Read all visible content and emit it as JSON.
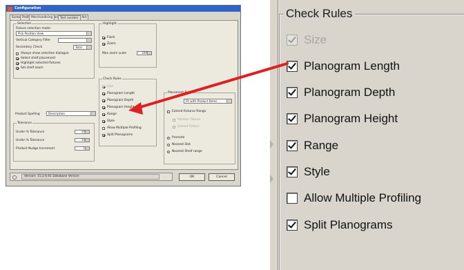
{
  "window": {
    "title": "Configuration",
    "tabs": [
      "Screen",
      "Profiling",
      "Configuration Profile",
      "Visual Aid",
      "Merchandising",
      "Test number"
    ],
    "selection": {
      "label": "Selection",
      "fixture_mode_label": "Fixture selection mode",
      "fixture_mode_value": "Pick Position View",
      "vertical_label": "Vertical Category Filter",
      "vertical_value": "",
      "secondary_label": "Secondary Check",
      "secondary_value": "Total"
    },
    "options": [
      {
        "label": "Always show selection dialogue",
        "checked": false
      },
      {
        "label": "Select shelf placement",
        "checked": true
      },
      {
        "label": "Highlight selected fixtures",
        "checked": true
      },
      {
        "label": "Set shelf zoom",
        "checked": true
      }
    ],
    "product_spelling": {
      "label": "Product Spelling",
      "value": "Description"
    },
    "tolerances": {
      "label": "Tolerance",
      "rows": [
        {
          "label": "Under % Tolerance",
          "value": "10"
        },
        {
          "label": "Under % Tolerance",
          "value": "10"
        },
        {
          "label": "Product Nudge Increment",
          "value": "1"
        }
      ]
    },
    "highlight": {
      "label": "Highlight",
      "items": [
        {
          "label": "Flash",
          "checked": true
        },
        {
          "label": "Zoom",
          "checked": true
        }
      ],
      "max_zoom_label": "Max zoom scale",
      "max_zoom_value": "100"
    },
    "check_rules_small": {
      "label": "Check Rules",
      "items": [
        {
          "label": "Size",
          "checked": true,
          "disabled": true
        },
        {
          "label": "Planogram Length",
          "checked": true
        },
        {
          "label": "Planogram Depth",
          "checked": true
        },
        {
          "label": "Planogram Height",
          "checked": true
        },
        {
          "label": "Range",
          "checked": true
        },
        {
          "label": "Style",
          "checked": true
        },
        {
          "label": "Allow Multiple Profiling",
          "checked": false
        },
        {
          "label": "Split Planograms",
          "checked": true
        }
      ]
    },
    "placement": {
      "label": "Placement Rules",
      "combo_value": "Fit with Product Items",
      "extend_label": "Extend Fixtures Range",
      "sub_items": [
        "Position Fixture",
        "Extend Fixture"
      ],
      "radios": [
        {
          "label": "Promote",
          "selected": false
        },
        {
          "label": "Nearest Slot",
          "selected": false
        },
        {
          "label": "Nearest Shelf range",
          "selected": false
        }
      ]
    },
    "status_text": "Version: 15.2.6.61 Database Version",
    "ok_label": "OK",
    "cancel_label": "Cancel"
  },
  "zoom": {
    "legend": "Check Rules",
    "items": [
      {
        "label": "Size",
        "checked": true,
        "disabled": true
      },
      {
        "label": "Planogram Length",
        "checked": true,
        "disabled": false
      },
      {
        "label": "Planogram Depth",
        "checked": true,
        "disabled": false
      },
      {
        "label": "Planogram Height",
        "checked": true,
        "disabled": false
      },
      {
        "label": "Range",
        "checked": true,
        "disabled": false
      },
      {
        "label": "Style",
        "checked": true,
        "disabled": false
      },
      {
        "label": "Allow Multiple Profiling",
        "checked": false,
        "disabled": false
      },
      {
        "label": "Split Planograms",
        "checked": true,
        "disabled": false
      }
    ]
  },
  "colors": {
    "arrow": "#e02020",
    "titlebar": "#2f64c8",
    "dialog_bg": "#ece9df"
  }
}
